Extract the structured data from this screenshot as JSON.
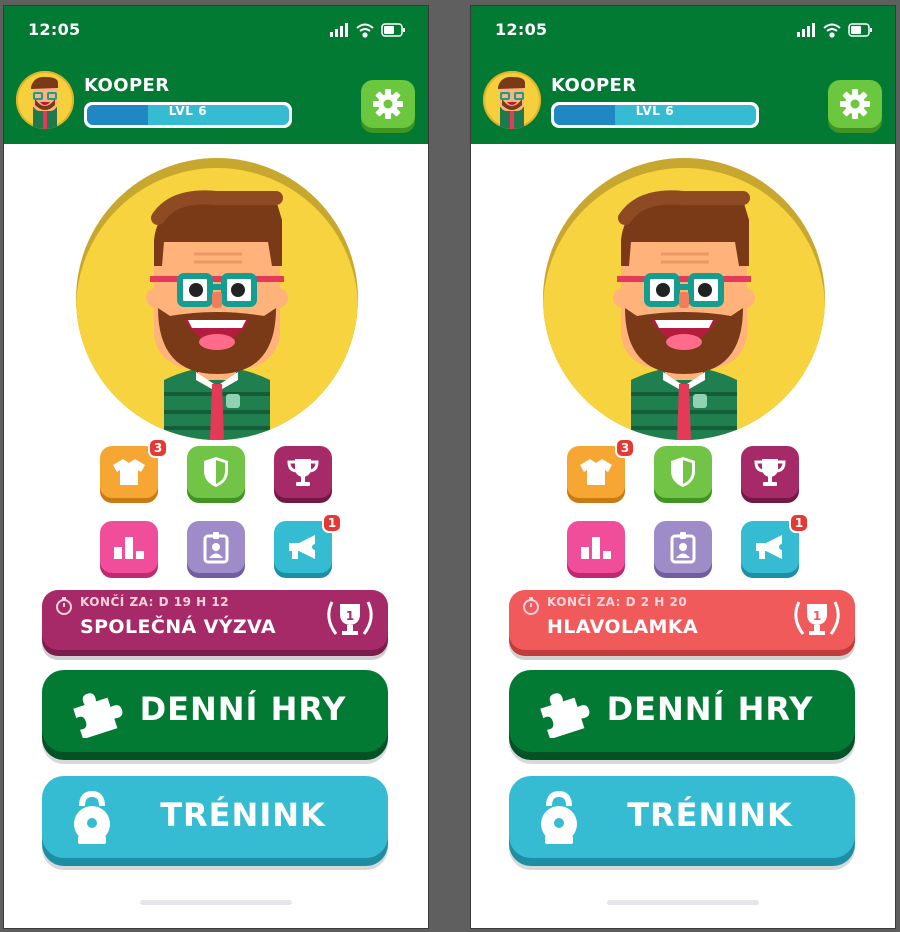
{
  "colors": {
    "header_green": "#027a34",
    "gold": "#f7d33f",
    "orange": "#f6a632",
    "green": "#72c447",
    "plum": "#a62a68",
    "pink": "#f04e9b",
    "lavender": "#9d8cc8",
    "cyan": "#36bcd2",
    "challenge_left": "#a62a68",
    "challenge_right": "#f05a5a"
  },
  "status": {
    "time": "12:05",
    "icons": [
      "signal-icon",
      "wifi-icon",
      "battery-icon"
    ]
  },
  "profile": {
    "username": "KOOPER",
    "level_label": "LVL 6",
    "level_progress": 0.3
  },
  "icon_grid": [
    {
      "name": "wardrobe",
      "icon": "tshirt-icon",
      "badge": "3"
    },
    {
      "name": "shield",
      "icon": "shield-icon",
      "badge": ""
    },
    {
      "name": "trophy",
      "icon": "trophy-icon",
      "badge": ""
    },
    {
      "name": "stats",
      "icon": "bar-chart-icon",
      "badge": ""
    },
    {
      "name": "profile-card",
      "icon": "id-badge-icon",
      "badge": ""
    },
    {
      "name": "news",
      "icon": "megaphone-icon",
      "badge": "1"
    }
  ],
  "screens": {
    "left": {
      "challenge": {
        "ends_label": "KONČÍ ZA: D 19 H 12",
        "title": "SPOLEČNÁ VÝZVA",
        "trophy_rank": "1"
      }
    },
    "right": {
      "challenge": {
        "ends_label": "KONČÍ ZA: D 2 H 20",
        "title": "HLAVOLAMKA",
        "trophy_rank": "1"
      }
    }
  },
  "buttons": {
    "daily_games": "DENNÍ HRY",
    "training": "TRÉNINK"
  }
}
